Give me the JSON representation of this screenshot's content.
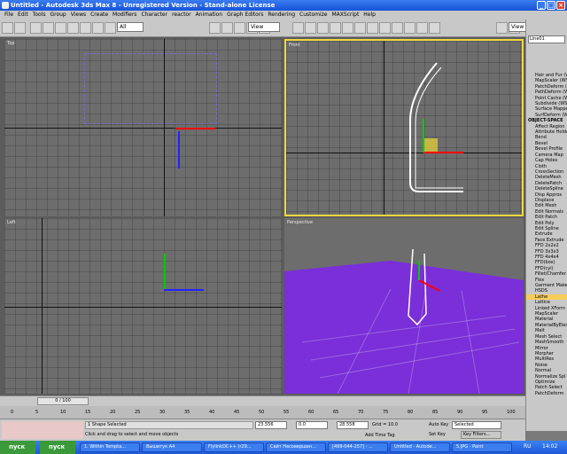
{
  "window": {
    "title": "Untitled  - Autodesk 3ds Max 8  - Unregistered Version  - Stand-alone License",
    "tab1": "Untitled",
    "tab2": "Untitled"
  },
  "menu": [
    "File",
    "Edit",
    "Tools",
    "Group",
    "Views",
    "Create",
    "Modifiers",
    "Character",
    "reactor",
    "Animation",
    "Graph Editors",
    "Rendering",
    "Customize",
    "MAXScript",
    "Help"
  ],
  "toolbar": {
    "selection_filter": "All",
    "coord_system": "View",
    "coord_system2": "View"
  },
  "viewports": {
    "top": "Top",
    "front": "Front",
    "left": "Left",
    "perspective": "Perspective"
  },
  "command_panel": {
    "object_name": "Line01",
    "modifiers": [
      "Hair and Fur (W",
      "MapScaler (WS",
      "PatchDeform (W",
      "PathDeform (W",
      "Point Cache (W",
      "Subdivide (WS",
      "Surface Mappe",
      "SurfDeform (W",
      "OBJECT-SPACE",
      "Affect Region",
      "Attribute Holder",
      "Bend",
      "Bevel",
      "Bevel Profile",
      "Camera Map",
      "Cap Holes",
      "Cloth",
      "CrossSection",
      "DeleteMesh",
      "DeletePatch",
      "DeleteSpline",
      "Disp Approx",
      "Displace",
      "Edit Mesh",
      "Edit Normals",
      "Edit Patch",
      "Edit Poly",
      "Edit Spline",
      "Extrude",
      "Face Extrude",
      "FFD 2x2x2",
      "FFD 3x3x3",
      "FFD 4x4x4",
      "FFD(box)",
      "FFD(cyl)",
      "Fillet/Chamfer",
      "Flex",
      "Garment Maker",
      "HSDS",
      "Lathe",
      "Lattice",
      "Linked XForm",
      "MapScaler",
      "Material",
      "MaterialByElem",
      "Melt",
      "Mesh Select",
      "MeshSmooth",
      "Mirror",
      "Morpher",
      "MultiRes",
      "Noise",
      "Normal",
      "Normalize Spl",
      "Optimize",
      "Patch Select",
      "PatchDeform"
    ],
    "section_header": "OBJECT-SPACE",
    "selected": "Lathe"
  },
  "timeline": {
    "frame": "0 / 100",
    "ticks": [
      "0",
      "5",
      "10",
      "15",
      "20",
      "25",
      "30",
      "35",
      "40",
      "45",
      "50",
      "55",
      "60",
      "65",
      "70",
      "75",
      "80",
      "85",
      "90",
      "95",
      "100"
    ]
  },
  "status": {
    "selection": "1 Shape Selected",
    "prompt": "Click and drag to select and move objects",
    "x": "23.556",
    "y": "0.0",
    "z": "28.558",
    "grid": "Grid = 10.0",
    "add_time_tag": "Add Time Tag",
    "auto_key": "Auto Key",
    "set_key": "Set Key",
    "selected": "Selected",
    "key_filters": "Key Filters..."
  },
  "taskbar": {
    "start": "пуск",
    "start2": "пуск",
    "items": [
      "1. Within Tempta...",
      "Вышитук А4",
      "FlylinkDC++ (r29...",
      "Сайт Несовершен...",
      "[499-044-257] - ...",
      "Untitled - Autode...",
      "5.JPG - Paint"
    ],
    "lang": "RU",
    "clock": "14:02"
  },
  "colors": {
    "selected_viewport": "#f0d840",
    "perspective_floor": "#7a2fd8",
    "modifier_highlight": "#f6cc5a",
    "titlebar": "#1652d6"
  }
}
